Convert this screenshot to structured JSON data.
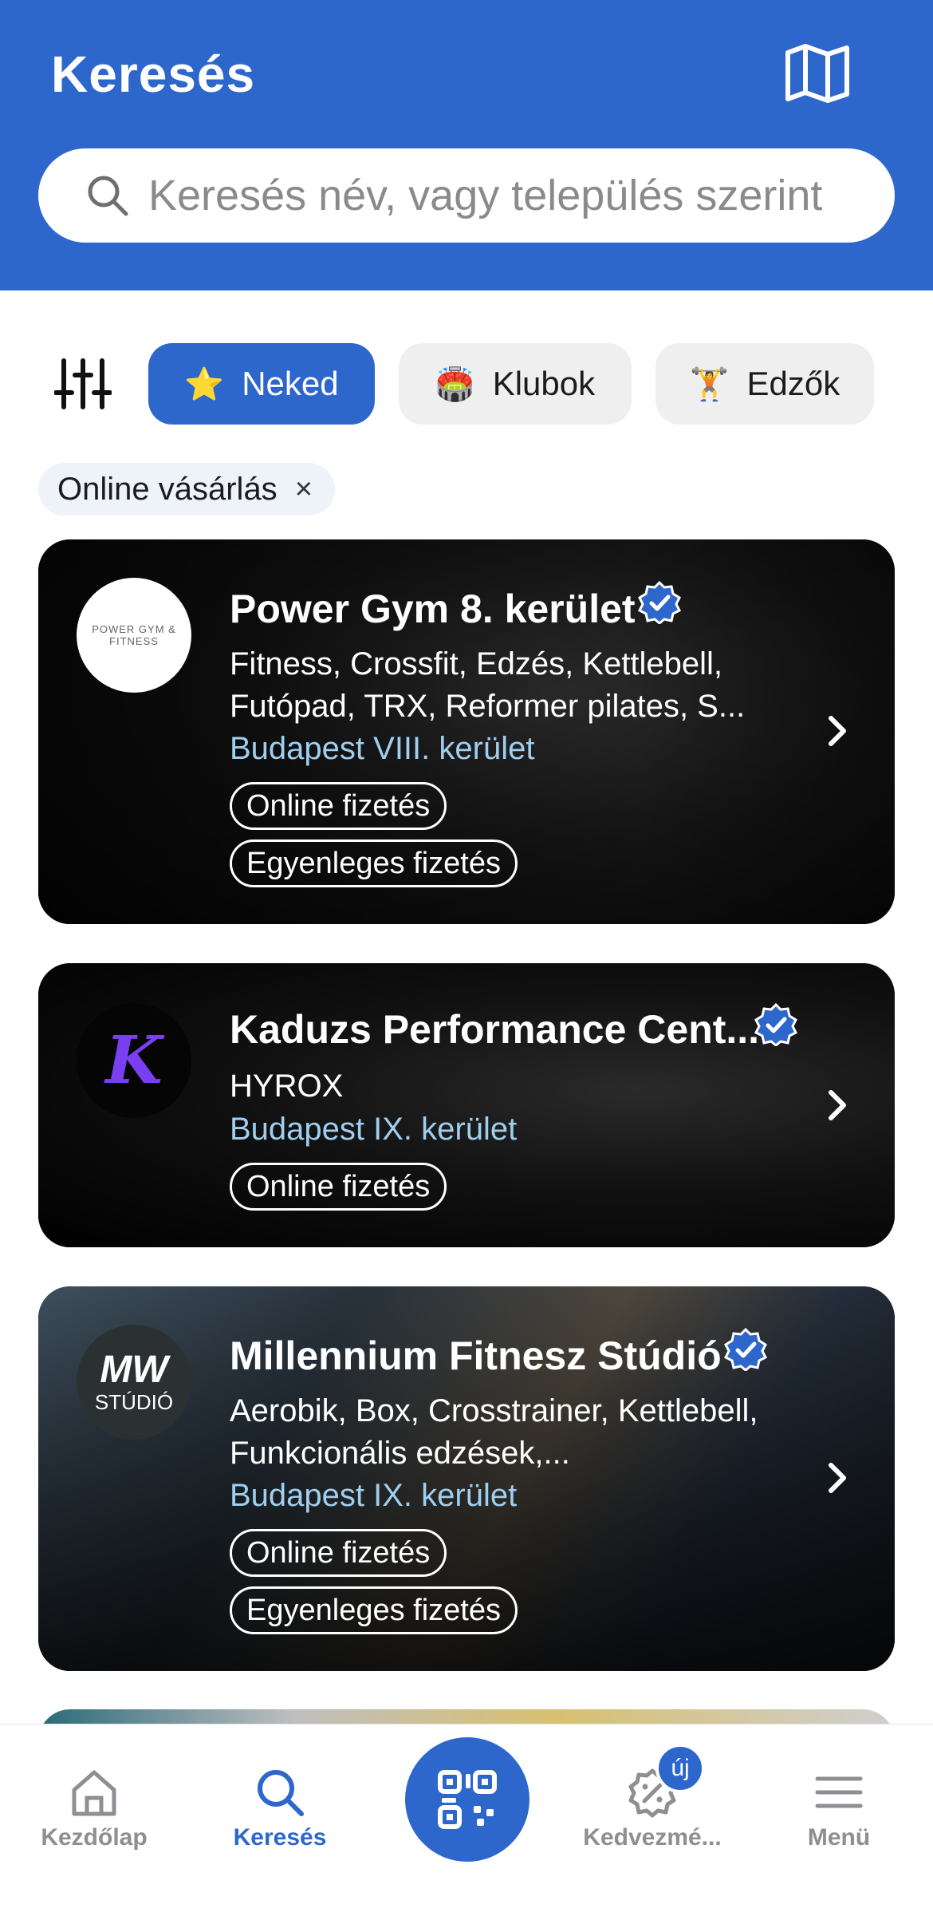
{
  "header": {
    "title": "Keresés",
    "map_icon": "map-icon",
    "search_icon": "search-icon",
    "search_placeholder": "Keresés név, vagy település szerint",
    "search_value": "",
    "bg_color": "#2e67cc"
  },
  "filters": {
    "filter_icon": "sliders-icon",
    "tabs": [
      {
        "icon": "⭐",
        "label": "Neked",
        "active": true
      },
      {
        "icon": "🏟️",
        "label": "Klubok",
        "active": false
      },
      {
        "icon": "🏋️",
        "label": "Edzők",
        "active": false
      }
    ],
    "chip": {
      "label": "Online vásárlás",
      "close": "×"
    }
  },
  "cards": [
    {
      "logo_text": "POWER GYM & FITNESS",
      "title": "Power Gym 8. kerület",
      "verified": true,
      "description": "Fitness, Crossfit, Edzés, Kettlebell, Futópad, TRX, Reformer pilates, S...",
      "location": "Budapest VIII. kerület",
      "tags": [
        "Online fizetés",
        "Egyenleges fizetés"
      ]
    },
    {
      "logo_text": "K",
      "title": "Kaduzs Performance Cent...",
      "verified": true,
      "description": "HYROX",
      "location": "Budapest IX. kerület",
      "tags": [
        "Online fizetés"
      ]
    },
    {
      "logo_text": "MW",
      "logo_subtext": "STÚDIÓ",
      "title": "Millennium Fitnesz Stúdió",
      "verified": true,
      "description": "Aerobik, Box, Crosstrainer, Kettlebell, Funkcionális edzések,...",
      "location": "Budapest IX. kerület",
      "tags": [
        "Online fizetés",
        "Egyenleges fizetés"
      ]
    }
  ],
  "bottom_nav": {
    "items": [
      {
        "icon": "home-icon",
        "label": "Kezdőlap",
        "active": false
      },
      {
        "icon": "search-icon",
        "label": "Keresés",
        "active": true
      },
      {
        "icon": "qr-code-icon",
        "label": "",
        "active": false
      },
      {
        "icon": "discount-badge-icon",
        "label": "Kedvezmé...",
        "active": false,
        "badge": "új"
      },
      {
        "icon": "menu-icon",
        "label": "Menü",
        "active": false
      }
    ]
  },
  "colors": {
    "accent": "#2e67cc",
    "location": "#9fcff0",
    "tab_bg": "#efefef"
  }
}
